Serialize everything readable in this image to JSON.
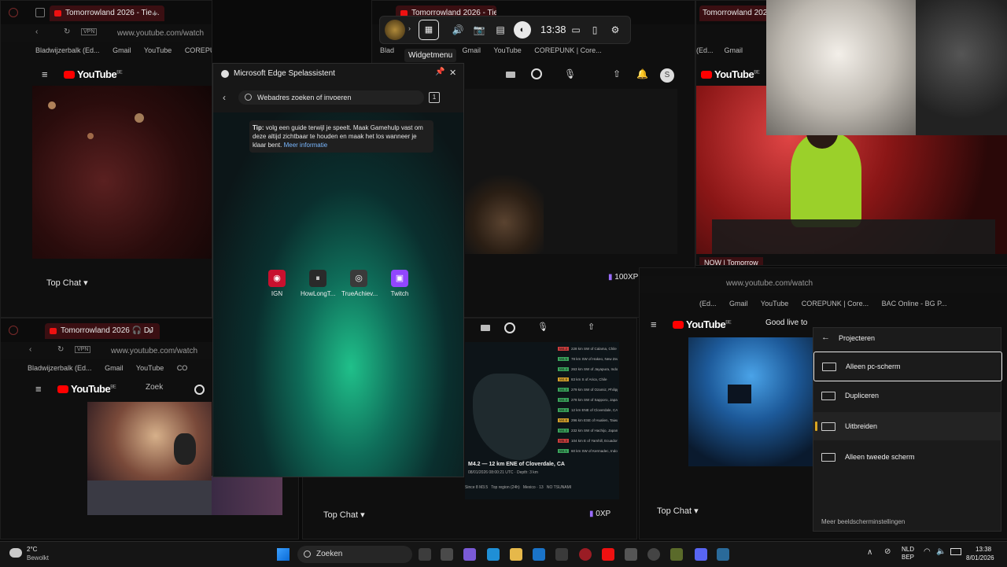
{
  "browser": {
    "tab_title": "Tomorrowland 2026 - Tie…",
    "tab_title_center": "Tomorrowland 2026 - Tie…",
    "tab_title_right": "Tomorrowland 2026 - Tie",
    "tab_title_bottom": "Tomorrowland 2026 🎧 DJ",
    "tab_title_right2": "NOW | Tomorrow",
    "url": "www.youtube.com/watch",
    "vpn": "VPN",
    "bookmarks": [
      "Bladwijzerbalk (Ed...",
      "Gmail",
      "YouTube",
      "COREPUNK | Core..."
    ],
    "bookmarks_center": [
      "Blad",
      "Gmail",
      "YouTube",
      "COREPUNK | Core..."
    ],
    "bookmarks_right": [
      "(Ed...",
      "Gmail",
      "YouTube",
      "COREPUNK | Core...",
      "BAC Online - BG P..."
    ],
    "bookmarks_right_top": [
      "(Ed...",
      "Gmail"
    ],
    "bookmarks_bottom": [
      "Bladwijzerbalk (Ed...",
      "Gmail",
      "YouTube",
      "CO"
    ]
  },
  "youtube": {
    "logo": "YouTube",
    "region": "BE",
    "top_chat": "Top Chat",
    "search_right": "Good live to",
    "search_bottom": "Zoek",
    "xp_center": "100XP",
    "xp_bottom": "0XP",
    "now_label": "NOW | Tomorrow"
  },
  "gamebar": {
    "time": "13:38",
    "tooltip": "Widgetmenu"
  },
  "assistant": {
    "title": "Microsoft Edge Spelassistent",
    "search_placeholder": "Webadres zoeken of invoeren",
    "tab_count": "1",
    "tip_label": "Tip:",
    "tip_text": " volg een guide terwijl je speelt. Maak Gamehulp vast om deze altijd zichtbaar te houden en maak het los wanneer je klaar bent.",
    "tip_link": "Meer informatie",
    "tiles": [
      {
        "label": "IGN",
        "color": "#c8102e",
        "glyph": "◉"
      },
      {
        "label": "HowLongT...",
        "color": "#2a2a2a",
        "glyph": "⏸"
      },
      {
        "label": "TrueAchiev...",
        "color": "#3a3a3a",
        "glyph": "◎"
      },
      {
        "label": "Twitch",
        "color": "#9146ff",
        "glyph": "▣"
      }
    ]
  },
  "earthquake": {
    "headline": "M4.2 — 12 km ENE of Cloverdale, CA",
    "sub": "08/01/2026 08:00:21 UTC · Depth: 3 km",
    "since": "Since 8 M3.5",
    "top_region": "Top region (24h)",
    "mexico": "Mexico · 13",
    "nz": "NO TSUNAMI",
    "events": [
      {
        "mag": "M4.2",
        "place": "228 km SW of Calama, Chile",
        "color": "#cc3d3d"
      },
      {
        "mag": "M4.5",
        "place": "78 km SW of Hakeo, New Zealand",
        "color": "#3aa55c"
      },
      {
        "mag": "M4.4",
        "place": "263 km SW of Jayapura, Indonesia",
        "color": "#3aa55c"
      },
      {
        "mag": "M4.8",
        "place": "83 km S of Arica, Chile",
        "color": "#d6a12b"
      },
      {
        "mag": "M4.3",
        "place": "279 km SW of Ozamiz, Philippines",
        "color": "#3aa55c"
      },
      {
        "mag": "M4.3",
        "place": "278 km SW of Sapporo, Japan",
        "color": "#3aa55c"
      },
      {
        "mag": "M4.2",
        "place": "12 km ENE of Cloverdale, CA",
        "color": "#3aa55c"
      },
      {
        "mag": "M4.8",
        "place": "296 km ESE of Hualien, Taiwan",
        "color": "#d6a12b"
      },
      {
        "mag": "M4.3",
        "place": "232 km SW of Hachijo, Japan",
        "color": "#3aa55c"
      },
      {
        "mag": "M5.3",
        "place": "104 km E of Yamhill, Ecuador",
        "color": "#cc3d3d"
      },
      {
        "mag": "M4.1",
        "place": "60 km SW of Kermadec, Indonesia",
        "color": "#3aa55c"
      }
    ]
  },
  "projection": {
    "title": "Projecteren",
    "options": [
      "Alleen pc-scherm",
      "Dupliceren",
      "Uitbreiden",
      "Alleen tweede scherm"
    ],
    "selected": "Alleen pc-scherm",
    "footer": "Meer beeldscherminstellingen"
  },
  "taskbar": {
    "weather_temp": "2°C",
    "weather_desc": "Bewolkt",
    "search_label": "Zoeken",
    "lang": "NLD",
    "lang2": "BEP",
    "time": "13:38",
    "date": "8/01/2026"
  }
}
